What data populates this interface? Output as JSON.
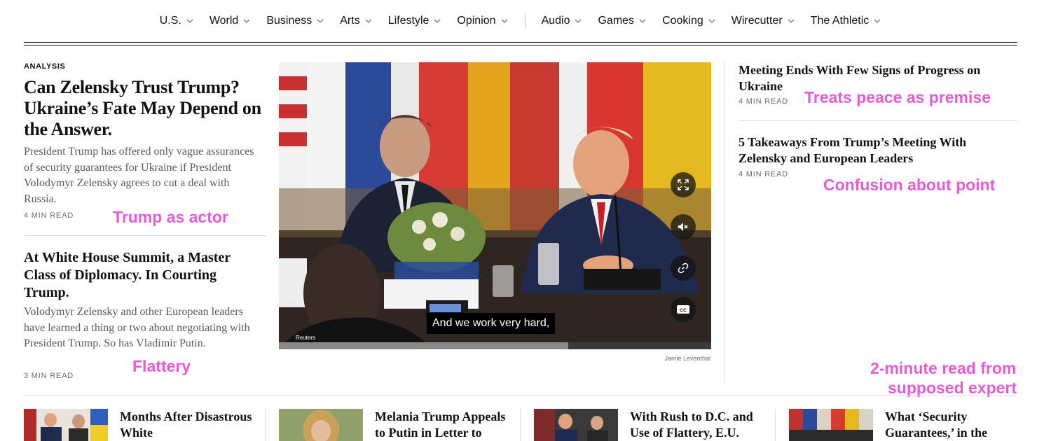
{
  "nav": {
    "items": [
      "U.S.",
      "World",
      "Business",
      "Arts",
      "Lifestyle",
      "Opinion"
    ],
    "items_right": [
      "Audio",
      "Games",
      "Cooking",
      "Wirecutter",
      "The Athletic"
    ]
  },
  "lead": {
    "kicker": "ANALYSIS",
    "headline": "Can Zelensky Trust Trump? Ukraine’s Fate May Depend on the Answer.",
    "summary": "President Trump has offered only vague assurances of security guarantees for Ukraine if President Volodymyr Zelensky agrees to cut a deal with Russia.",
    "read_time": "4 MIN READ",
    "annotation": "Trump as actor"
  },
  "second": {
    "headline": "At White House Summit, a Master Class of Diplomacy. In Courting Trump.",
    "summary": "Volodymyr Zelensky and other European leaders have learned a thing or two about negotiating with President Trump. So has Vladimir Putin.",
    "read_time": "3 MIN READ",
    "annotation": "Flattery"
  },
  "video": {
    "caption": "And we work very hard,",
    "source": "Reuters",
    "credit": "Jamie Leventhal",
    "progress": 0.67
  },
  "right": [
    {
      "headline": "Meeting Ends With Few Signs of Progress on Ukraine",
      "read_time": "4 MIN READ",
      "annotation": "Treats peace as premise"
    },
    {
      "headline": "5 Takeaways From Trump’s Meeting With Zelensky and European Leaders",
      "read_time": "4 MIN READ",
      "annotation": "Confusion about point"
    }
  ],
  "corner_annotation": {
    "line1": "2-minute read from",
    "line2": "supposed expert"
  },
  "bottom": [
    {
      "title": "Months After Disastrous White"
    },
    {
      "title": "Melania Trump Appeals to Putin in Letter to"
    },
    {
      "title": "With Rush to D.C. and Use of Flattery, E.U."
    },
    {
      "title": "What ‘Security Guarantees,’ in the"
    }
  ],
  "colors": {
    "annotation": "#e75bd9",
    "text": "#121212",
    "muted": "#5a5a5a"
  }
}
